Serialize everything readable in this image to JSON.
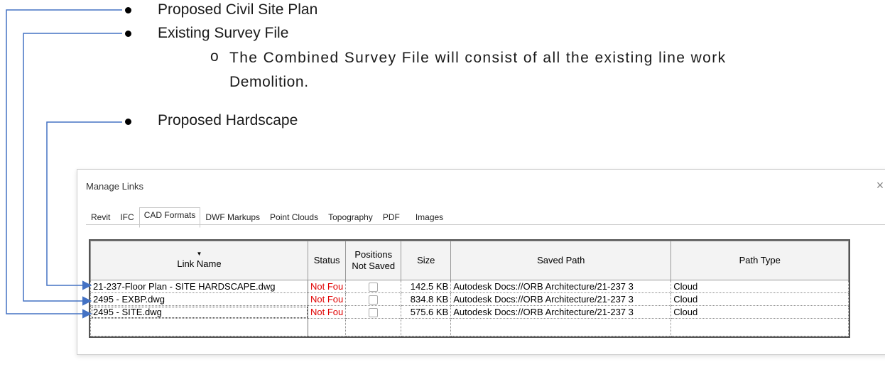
{
  "document": {
    "bullets": [
      {
        "label": "Proposed Civil Site Plan"
      },
      {
        "label": "Existing Survey File"
      },
      {
        "label": "Proposed Hardscape"
      }
    ],
    "sub_bullet_marker": "o",
    "sub_bullet_line1": "The Combined Survey File will consist of all the existing line work",
    "sub_bullet_line2": "Demolition."
  },
  "dialog": {
    "title": "Manage Links",
    "close_glyph": "×",
    "tabs": [
      "Revit",
      "IFC",
      "CAD Formats",
      "DWF Markups",
      "Point Clouds",
      "Topography",
      "PDF",
      "Images"
    ],
    "active_tab": "CAD Formats",
    "columns": {
      "link_name": "Link Name",
      "sort_glyph": "▼",
      "status": "Status",
      "positions_line1": "Positions",
      "positions_line2": "Not Saved",
      "size": "Size",
      "saved_path": "Saved Path",
      "path_type": "Path Type"
    },
    "rows": [
      {
        "name": "21-237-Floor Plan - SITE HARDSCAPE.dwg",
        "status": "Not Fou",
        "size": "142.5 KB",
        "path": "Autodesk Docs://ORB Architecture/21-237 3",
        "type": "Cloud"
      },
      {
        "name": "2495 - EXBP.dwg",
        "status": "Not Fou",
        "size": "834.8 KB",
        "path": "Autodesk Docs://ORB Architecture/21-237 3",
        "type": "Cloud"
      },
      {
        "name": "2495 - SITE.dwg",
        "status": "Not Fou",
        "size": "575.6 KB",
        "path": "Autodesk Docs://ORB Architecture/21-237 3",
        "type": "Cloud"
      }
    ]
  },
  "colors": {
    "arrow": "#4472c4",
    "status_not_found": "#e00000"
  }
}
